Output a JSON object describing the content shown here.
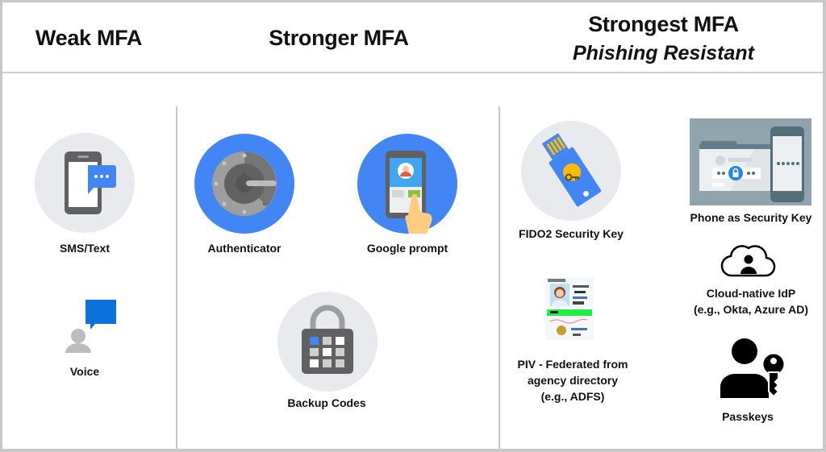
{
  "columns": [
    {
      "title": "Weak MFA",
      "methods": [
        {
          "label": "SMS/Text",
          "icon": "sms-phone-icon"
        },
        {
          "label": "Voice",
          "icon": "voice-call-icon"
        }
      ]
    },
    {
      "title": "Stronger MFA",
      "methods": [
        {
          "label": "Authenticator",
          "icon": "authenticator-app-icon"
        },
        {
          "label": "Google prompt",
          "icon": "google-prompt-icon"
        },
        {
          "label": "Backup Codes",
          "icon": "backup-codes-lock-icon"
        }
      ]
    },
    {
      "title": "Strongest MFA",
      "subtitle": "Phishing Resistant",
      "methods": [
        {
          "label": "FIDO2 Security Key",
          "icon": "security-key-icon"
        },
        {
          "label": "Phone as Security Key",
          "icon": "phone-security-key-icon"
        },
        {
          "label_lines": [
            "Cloud-native IdP",
            "(e.g., Okta, Azure AD)"
          ],
          "icon": "cloud-user-icon"
        },
        {
          "label_lines": [
            "PIV - Federated from",
            "agency directory",
            "(e.g., ADFS)"
          ],
          "icon": "piv-card-icon"
        },
        {
          "label": "Passkeys",
          "icon": "passkey-user-key-icon"
        }
      ]
    }
  ],
  "colors": {
    "google_blue": "#4285f4",
    "circle_grey": "#e8eaed",
    "icon_dark_grey": "#616161",
    "key_yellow": "#fbbc04",
    "border_grey": "#c8c8c8"
  }
}
